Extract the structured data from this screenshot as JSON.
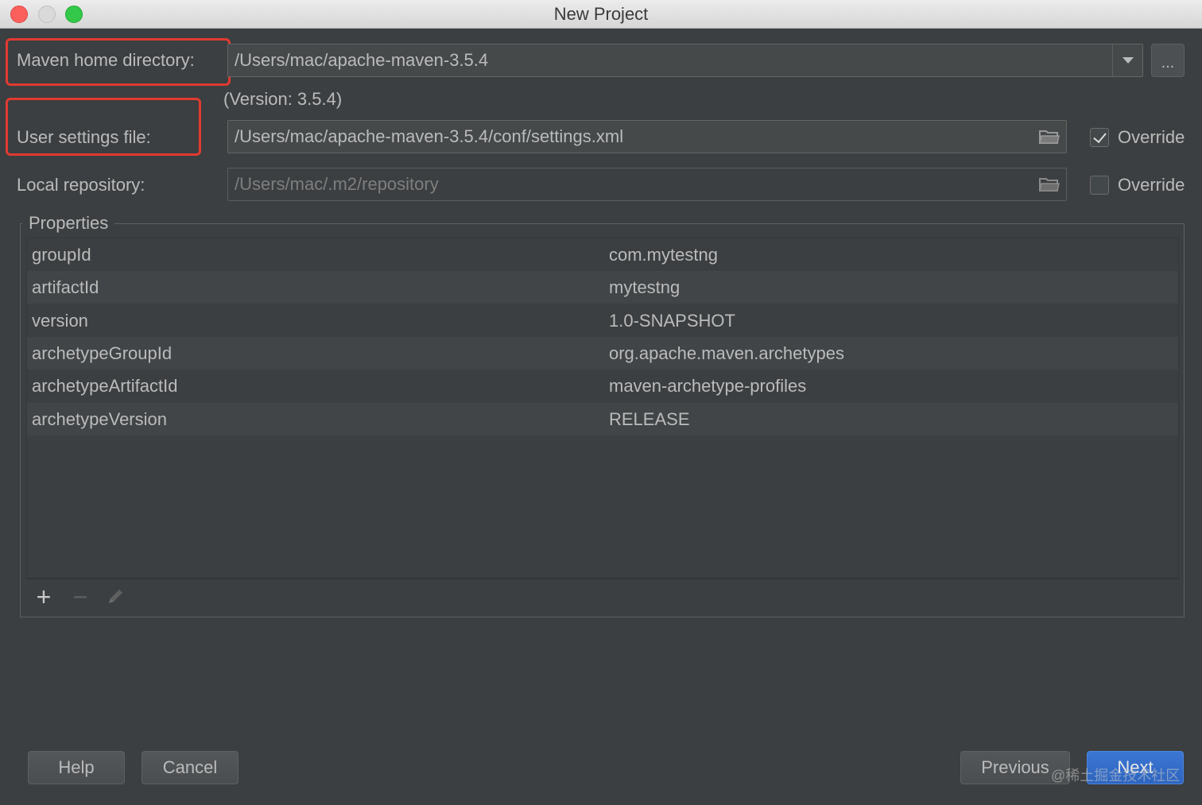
{
  "window": {
    "title": "New Project"
  },
  "maven_home": {
    "label": "Maven home directory:",
    "value": "/Users/mac/apache-maven-3.5.4",
    "version": "(Version: 3.5.4)",
    "browse_label": "..."
  },
  "user_settings": {
    "label": "User settings file:",
    "value": "/Users/mac/apache-maven-3.5.4/conf/settings.xml",
    "override_label": "Override",
    "override_checked": true
  },
  "local_repo": {
    "label": "Local repository:",
    "value": "/Users/mac/.m2/repository",
    "override_label": "Override",
    "override_checked": false
  },
  "properties": {
    "title": "Properties",
    "rows": [
      {
        "key": "groupId",
        "value": "com.mytestng"
      },
      {
        "key": "artifactId",
        "value": "mytestng"
      },
      {
        "key": "version",
        "value": "1.0-SNAPSHOT"
      },
      {
        "key": "archetypeGroupId",
        "value": "org.apache.maven.archetypes"
      },
      {
        "key": "archetypeArtifactId",
        "value": "maven-archetype-profiles"
      },
      {
        "key": "archetypeVersion",
        "value": "RELEASE"
      }
    ],
    "toolbar": {
      "add": "+",
      "remove": "−"
    }
  },
  "buttons": {
    "help": "Help",
    "cancel": "Cancel",
    "previous": "Previous",
    "next": "Next"
  },
  "watermark": "@稀土掘金技术社区",
  "colors": {
    "highlight": "#e03a32",
    "background": "#3c3f41",
    "primary_button": "#3574f0"
  },
  "icons": {
    "folder": "folder-icon",
    "dropdown": "chevron-down-icon",
    "add": "plus-icon",
    "remove": "minus-icon",
    "edit": "pencil-icon"
  }
}
